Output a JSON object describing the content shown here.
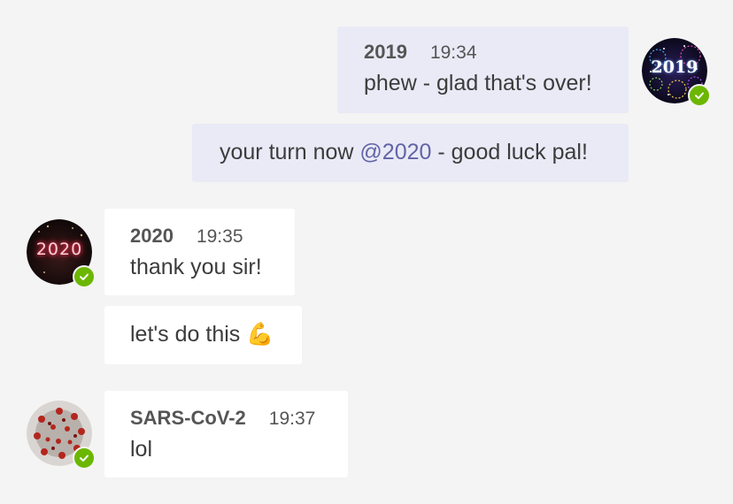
{
  "messages": [
    {
      "sender": "2019",
      "time": "19:34",
      "text": "phew - glad that's over!"
    },
    {
      "text_before": "your turn now ",
      "mention": "@2020",
      "text_after": " - good luck pal!"
    },
    {
      "sender": "2020",
      "time": "19:35",
      "text": "thank you sir!"
    },
    {
      "text": "let's do this",
      "emoji": "💪"
    },
    {
      "sender": "SARS-CoV-2",
      "time": "19:37",
      "text": "lol"
    }
  ],
  "avatars": {
    "a2019": {
      "label": "2019",
      "icon": "fireworks-avatar",
      "status": "available"
    },
    "a2020": {
      "label": "2020",
      "icon": "neon-sign-avatar",
      "status": "available"
    },
    "acovid": {
      "icon": "coronavirus-avatar",
      "status": "available"
    }
  },
  "colors": {
    "background": "#f4f4f4",
    "own_bubble": "#e9eaf6",
    "other_bubble": "#ffffff",
    "mention": "#6264a7",
    "presence": "#6bb700"
  }
}
